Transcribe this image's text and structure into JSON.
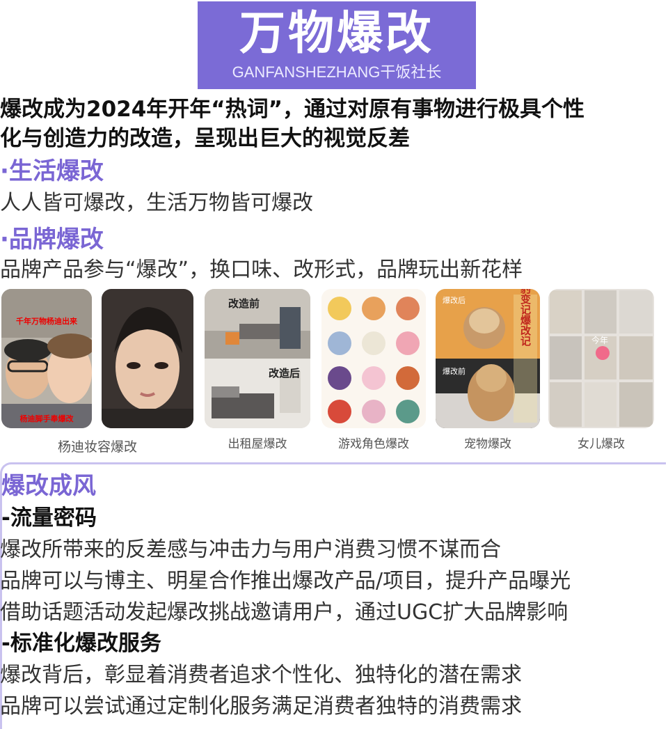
{
  "banner": {
    "title": "万物爆改",
    "subtitle": "GANFANSHEZHANG干饭社长",
    "color": "#7b6bd6"
  },
  "intro": {
    "line1": "爆改成为2024年开年“热词”，通过对原有事物进行极具个性",
    "line2": "化与创造力的改造，呈现出巨大的视觉反差"
  },
  "life": {
    "heading": "·生活爆改",
    "text": "人人皆可爆改，生活万物皆可爆改"
  },
  "brand": {
    "heading": "·品牌爆改",
    "text": "品牌产品参与“爆改”，换口味、改形式，品牌玩出新花样"
  },
  "gallery": {
    "captions": [
      "杨迪妆容爆改",
      "出租屋爆改",
      "游戏角色爆改",
      "宠物爆改",
      "女儿爆改"
    ],
    "overlays": {
      "room_before": "改造前",
      "room_after": "改造后",
      "pet_top": "爆改后",
      "pet_bottom": "爆改前",
      "pet_vertical": "臭宝豹变记爆改记",
      "girl_tag": "今年",
      "yangdi_top": "千年万物杨迪出来",
      "yangdi_bottom": "杨迪脚手奉爆改"
    }
  },
  "trend": {
    "heading": "爆改成风",
    "traffic": {
      "heading": "-流量密码",
      "lines": [
        "爆改所带来的反差感与冲击力与用户消费习惯不谋而合",
        "品牌可以与博主、明星合作推出爆改产品/项目，提升产品曝光",
        "借助话题活动发起爆改挑战邀请用户，通过UGC扩大品牌影响"
      ]
    },
    "service": {
      "heading": "-标准化爆改服务",
      "lines": [
        "爆改背后，彰显着消费者追求个性化、独特化的潜在需求",
        "品牌可以尝试通过定制化服务满足消费者独特的消费需求"
      ]
    }
  },
  "colors": {
    "accent": "#7a66d4",
    "frame": "#c9c2ef"
  }
}
